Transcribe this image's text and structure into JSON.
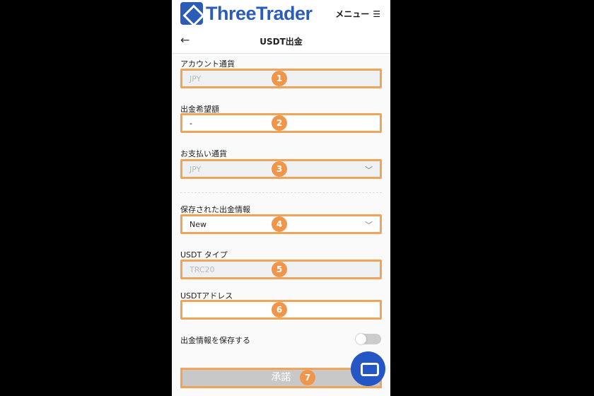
{
  "header": {
    "brand": "ThreeTrader",
    "menu_label": "メニュー",
    "title": "USDT出金"
  },
  "form": {
    "account_currency": {
      "label": "アカウント通貨",
      "value": "JPY",
      "badge": "1"
    },
    "amount": {
      "label": "出金希望額",
      "value": "-",
      "badge": "2"
    },
    "payment_currency": {
      "label": "お支払い通貨",
      "value": "JPY",
      "badge": "3"
    },
    "saved_info": {
      "label": "保存された出金情報",
      "value": "New",
      "badge": "4"
    },
    "usdt_type": {
      "label": "USDT タイプ",
      "value": "TRC20",
      "badge": "5"
    },
    "usdt_address": {
      "label": "USDTアドレス",
      "value": "",
      "badge": "6"
    },
    "save_toggle": {
      "label": "出金情報を保存する",
      "on": false
    },
    "submit": {
      "label": "承諾",
      "badge": "7"
    }
  },
  "colors": {
    "brand": "#2a5cb8",
    "highlight": "#f0a45a",
    "chat": "#2456c4"
  }
}
